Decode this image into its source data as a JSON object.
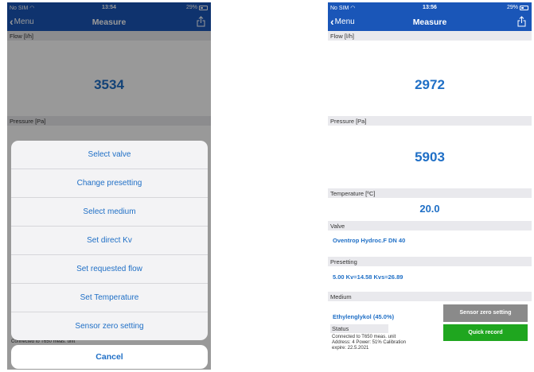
{
  "left": {
    "status": {
      "carrier": "No SIM",
      "time": "13:54",
      "battery": "29%"
    },
    "nav": {
      "back": "Menu",
      "title": "Measure"
    },
    "flow": {
      "label": "Flow [l/h]",
      "value": "3534"
    },
    "pressure": {
      "label": "Pressure [Pa]"
    },
    "status_text_line": "Connected to T650 meas. unit",
    "sheet": {
      "items": [
        "Select valve",
        "Change presetting",
        "Select medium",
        "Set direct Kv",
        "Set requested flow",
        "Set Temperature",
        "Sensor zero setting"
      ],
      "cancel": "Cancel"
    }
  },
  "right": {
    "status": {
      "carrier": "No SIM",
      "time": "13:56",
      "battery": "29%"
    },
    "nav": {
      "back": "Menu",
      "title": "Measure"
    },
    "flow": {
      "label": "Flow [l/h]",
      "value": "2972"
    },
    "pressure": {
      "label": "Pressure [Pa]",
      "value": "5903"
    },
    "temperature": {
      "label": "Temperature [ºC]",
      "value": "20.0"
    },
    "valve": {
      "label": "Valve",
      "value": "Oventrop Hydroc.F  DN 40"
    },
    "presetting": {
      "label": "Presetting",
      "value": "5.00 Kv=14.58 Kvs=26.89"
    },
    "medium": {
      "label": "Medium",
      "value": "Ethylenglykol (45.0%)"
    },
    "buttons": {
      "zero": "Sensor zero setting",
      "record": "Quick record"
    },
    "status_section": {
      "label": "Status",
      "lines": [
        "Connected to T650 meas. unit",
        "Address: 4 Power: 51% Calibration",
        "expire: 22.5.2021"
      ]
    }
  },
  "colors": {
    "nav": "#1a56b8",
    "accent": "#1f6fc6",
    "green": "#1fa61f",
    "gray_button": "#8a8a8a"
  }
}
